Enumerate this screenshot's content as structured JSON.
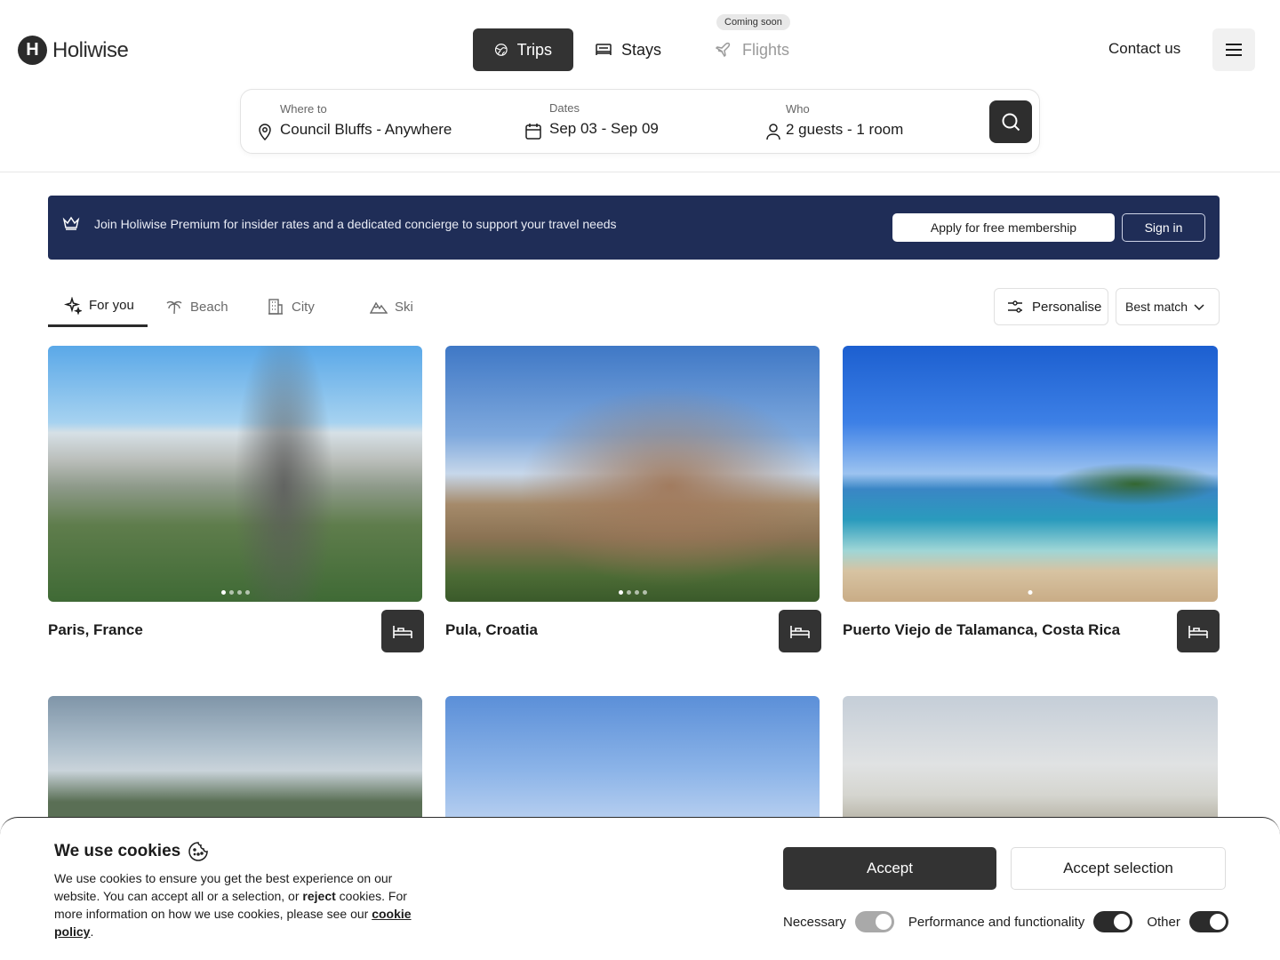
{
  "brand": {
    "logo_letter": "H",
    "name": "Holiwise"
  },
  "nav": {
    "items": [
      {
        "label": "Trips",
        "icon": "globe-icon",
        "state": "active"
      },
      {
        "label": "Stays",
        "icon": "bed-icon",
        "state": "normal"
      },
      {
        "label": "Flights",
        "icon": "plane-icon",
        "state": "disabled"
      }
    ],
    "flights_badge": "Coming soon",
    "contact_label": "Contact us"
  },
  "search": {
    "where_label": "Where to",
    "where_value": "Council Bluffs - Anywhere",
    "dates_label": "Dates",
    "dates_value": "Sep 03 - Sep 09",
    "who_label": "Who",
    "who_value": "2 guests - 1 room"
  },
  "banner": {
    "text": "Join Holiwise Premium for insider rates and a dedicated concierge to support your travel needs",
    "apply_label": "Apply for free membership",
    "signin_label": "Sign in"
  },
  "tabs": [
    {
      "label": "For you",
      "icon": "sparkle-icon",
      "active": true
    },
    {
      "label": "Beach",
      "icon": "palm-icon",
      "active": false
    },
    {
      "label": "City",
      "icon": "building-icon",
      "active": false
    },
    {
      "label": "Ski",
      "icon": "mountain-icon",
      "active": false
    }
  ],
  "filters": {
    "personalise_label": "Personalise",
    "sort_label": "Best match"
  },
  "cards": [
    {
      "title": "Paris, France",
      "dots": 4,
      "active_dot": 0
    },
    {
      "title": "Pula, Croatia",
      "dots": 4,
      "active_dot": 0
    },
    {
      "title": "Puerto Viejo de Talamanca, Costa Rica",
      "dots": 1,
      "active_dot": 0
    }
  ],
  "cookies": {
    "title": "We use cookies",
    "text_part1": "We use cookies to ensure you get the best experience on our website. You can accept all or a selection, or ",
    "text_reject": "reject",
    "text_part2": " cookies. For more information on how we use cookies, please see our ",
    "policy_link": "cookie policy",
    "text_end": ".",
    "accept_label": "Accept",
    "accept_selection_label": "Accept selection",
    "toggles": [
      {
        "label": "Necessary",
        "on": true,
        "locked": true
      },
      {
        "label": "Performance and functionality",
        "on": true,
        "locked": false
      },
      {
        "label": "Other",
        "on": true,
        "locked": false
      }
    ]
  },
  "colors": {
    "banner": "#1f2d57",
    "dark": "#333333",
    "muted": "#9a9a9a"
  }
}
